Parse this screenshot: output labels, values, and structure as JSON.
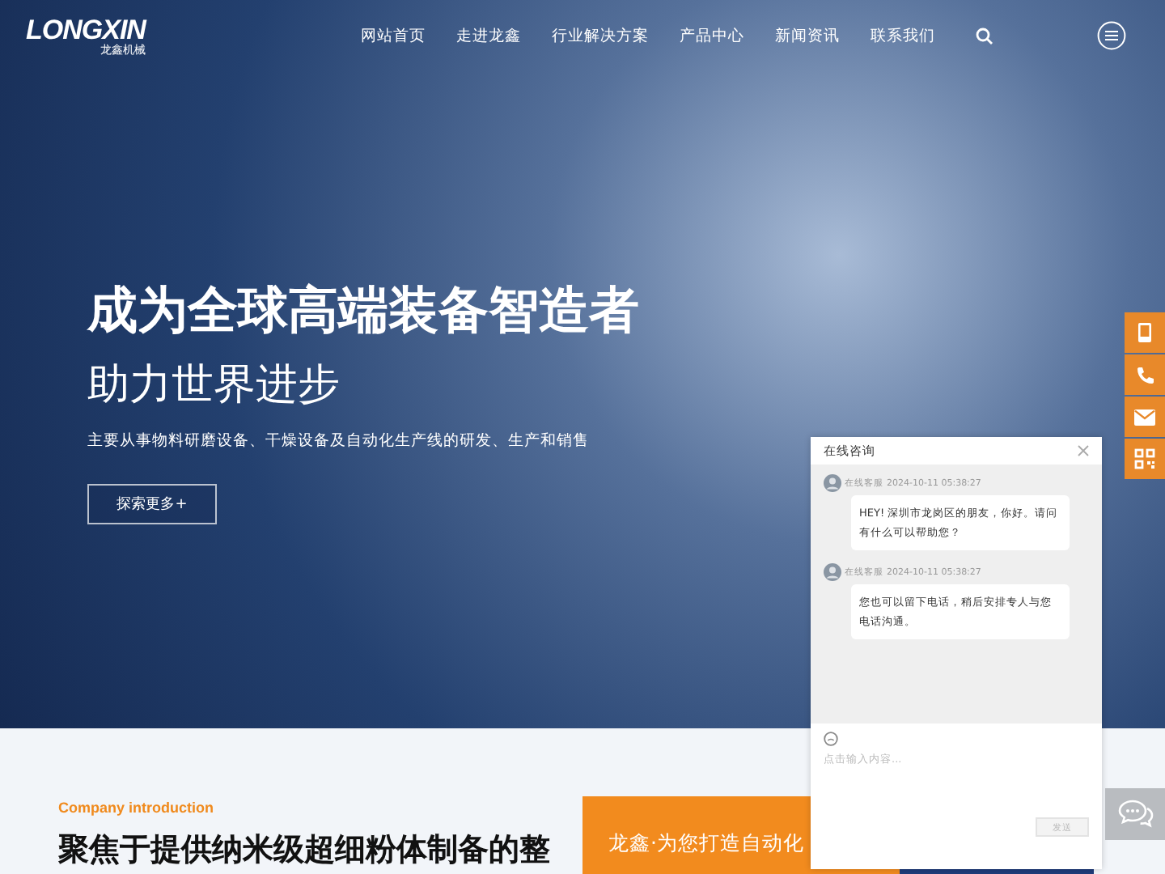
{
  "logo": {
    "name": "LONGXIN",
    "subtitle": "龙鑫机械"
  },
  "nav": [
    {
      "label": "网站首页"
    },
    {
      "label": "走进龙鑫"
    },
    {
      "label": "行业解决方案"
    },
    {
      "label": "产品中心"
    },
    {
      "label": "新闻资讯"
    },
    {
      "label": "联系我们"
    }
  ],
  "hero": {
    "title": "成为全球高端装备智造者",
    "subtitle": "助力世界进步",
    "description": "主要从事物料研磨设备、干燥设备及自动化生产线的研发、生产和销售",
    "button": "探索更多+"
  },
  "side_tools": [
    {
      "kind": "mobile"
    },
    {
      "kind": "phone"
    },
    {
      "kind": "mail"
    },
    {
      "kind": "qr"
    }
  ],
  "intro": {
    "eyebrow": "Company introduction",
    "heading": "聚焦于提供纳米级超细粉体制备的整",
    "card_text": "龙鑫·为您打造自动化"
  },
  "chat": {
    "title": "在线咨询",
    "messages": [
      {
        "sender": "在线客服",
        "time": "2024-10-11 05:38:27",
        "text": "HEY! 深圳市龙岗区的朋友，你好。请问有什么可以帮助您？"
      },
      {
        "sender": "在线客服",
        "time": "2024-10-11 05:38:27",
        "text": "您也可以留下电话，稍后安排专人与您电话沟通。"
      }
    ],
    "placeholder": "点击输入内容...",
    "send": "发送"
  }
}
